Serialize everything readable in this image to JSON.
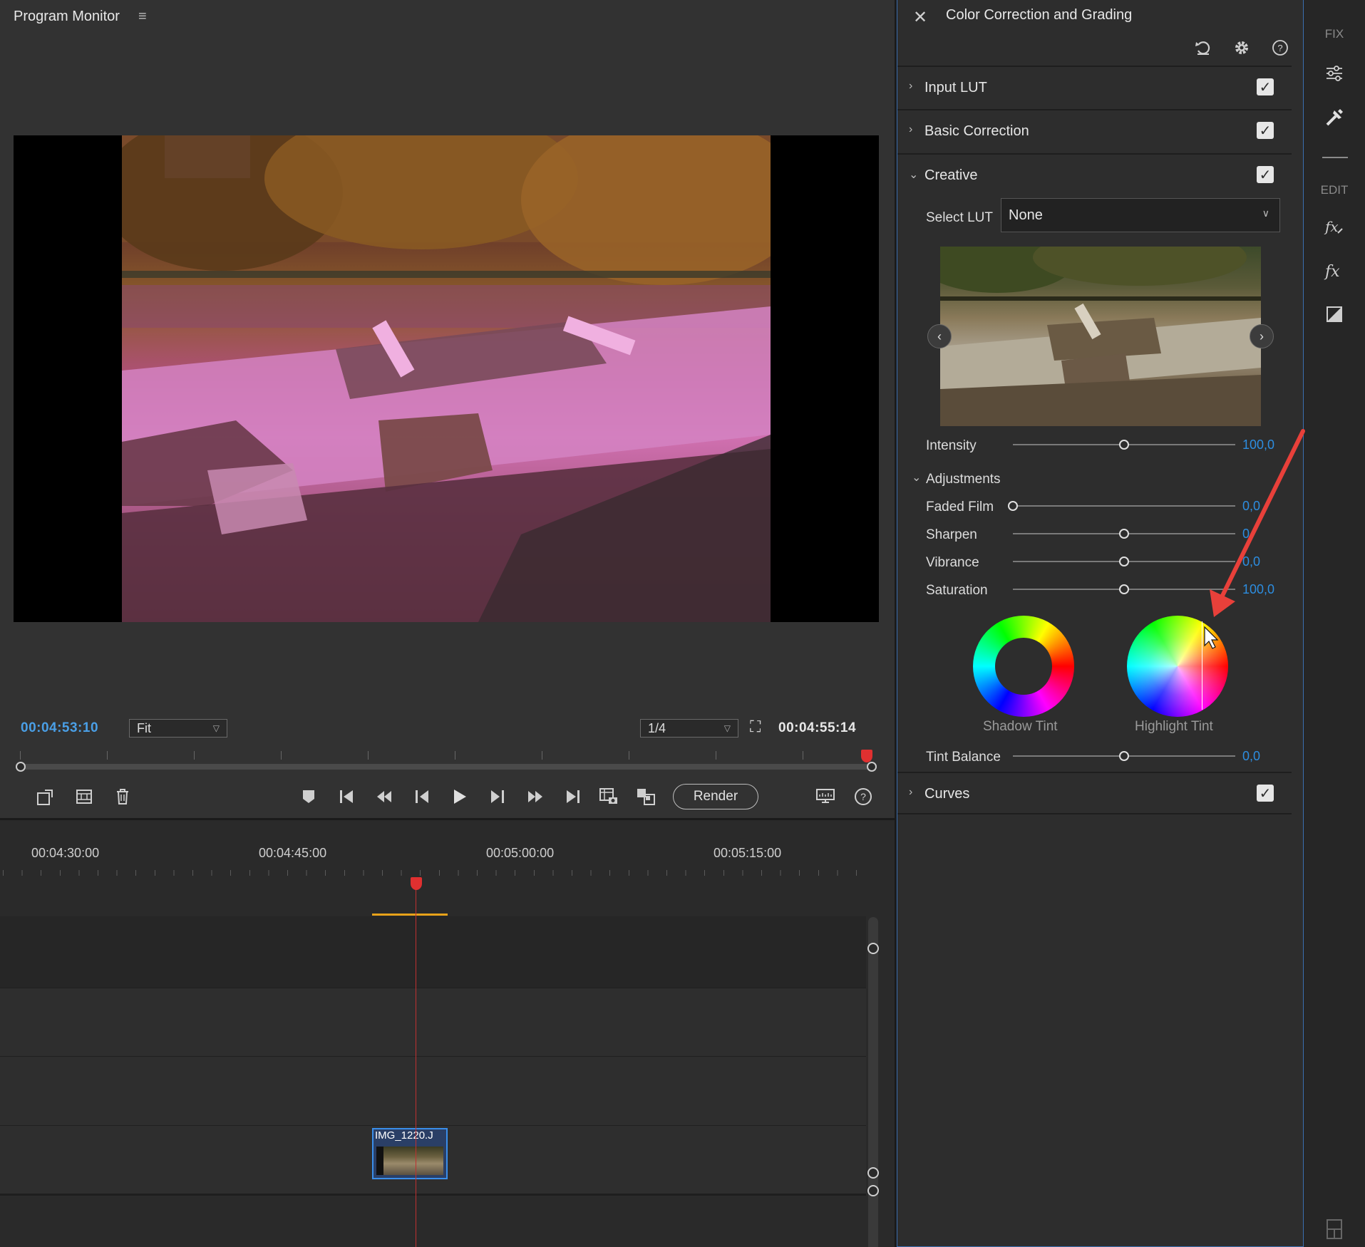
{
  "monitor": {
    "title": "Program Monitor",
    "menu_icon": "hamburger-icon",
    "timecode_current": "00:04:53:10",
    "fit_dropdown": "Fit",
    "resolution_dropdown": "1/4",
    "timecode_end": "00:04:55:14",
    "render_label": "Render",
    "transport_icons": [
      "export-frame-icon",
      "storyboard-icon",
      "delete-icon",
      "marker-icon",
      "go-to-in-icon",
      "step-back-icon",
      "frame-back-icon",
      "play-icon",
      "frame-forward-icon",
      "step-forward-icon",
      "go-to-out-icon",
      "capture-frame-icon",
      "overwrite-icon",
      "monitor-settings-icon",
      "help-icon"
    ]
  },
  "timeline": {
    "ruler_labels": [
      "00:04:30:00",
      "00:04:45:00",
      "00:05:00:00",
      "00:05:15:00"
    ],
    "clip_label": "IMG_1220.J"
  },
  "color_panel": {
    "title": "Color Correction and Grading",
    "sections": {
      "input_lut": "Input LUT",
      "basic_correction": "Basic Correction",
      "creative": "Creative",
      "adjustments": "Adjustments",
      "curves": "Curves"
    },
    "select_lut_label": "Select LUT",
    "select_lut_value": "None",
    "intensity": {
      "label": "Intensity",
      "value": "100,0",
      "fraction": 0.5
    },
    "faded_film": {
      "label": "Faded Film",
      "value": "0,0",
      "fraction": 0.0
    },
    "sharpen": {
      "label": "Sharpen",
      "value": "0",
      "fraction": 0.5
    },
    "vibrance": {
      "label": "Vibrance",
      "value": "0,0",
      "fraction": 0.5
    },
    "saturation": {
      "label": "Saturation",
      "value": "100,0",
      "fraction": 0.5
    },
    "shadow_tint_label": "Shadow Tint",
    "highlight_tint_label": "Highlight Tint",
    "tint_balance": {
      "label": "Tint Balance",
      "value": "0,0",
      "fraction": 0.5
    },
    "checkmark": "✓"
  },
  "sidebar": {
    "fix_label": "FIX",
    "edit_label": "EDIT"
  },
  "colors": {
    "accent_blue": "#2d8de0",
    "timecode_blue": "#4a9fe6",
    "playhead_red": "#e03030",
    "annotation_red": "#e8403a"
  }
}
